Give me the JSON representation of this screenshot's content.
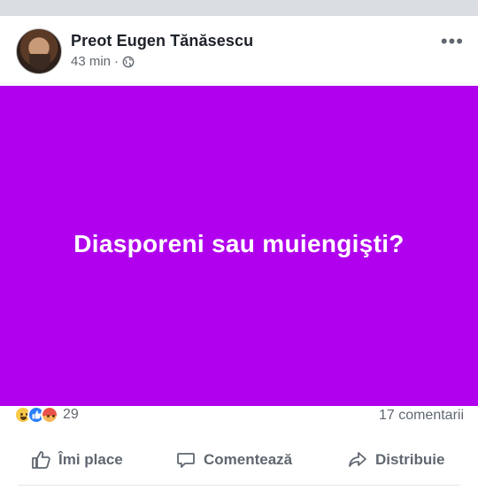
{
  "post": {
    "author": "Preot Eugen Tănăsescu",
    "time": "43 min",
    "dot": "·",
    "more_label": "•••",
    "image_text": "Diasporeni sau muiengişti?"
  },
  "stats": {
    "reactions": [
      "haha",
      "like",
      "angry"
    ],
    "reaction_count": "29",
    "comments": "17 comentarii"
  },
  "actions": {
    "like_label": "Îmi place",
    "comment_label": "Comentează",
    "share_label": "Distribuie"
  },
  "colors": {
    "image_background": "#b100ee",
    "text_muted": "#606770"
  }
}
